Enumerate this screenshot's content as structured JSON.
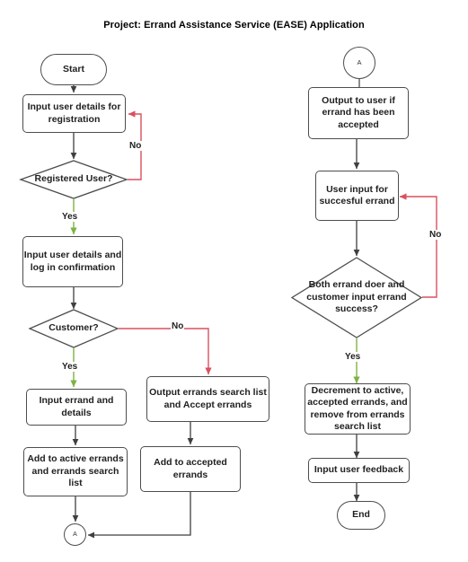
{
  "title": "Project: Errand Assistance Service (EASE) Application",
  "colors": {
    "node_stroke": "#4d4d4d",
    "flow_arrow": "#3f3f3f",
    "no_edge": "#d9515d",
    "yes_edge": "#7cb342",
    "text": "#1f1f1f",
    "background": "#ffffff"
  },
  "nodes": {
    "start": {
      "label": "Start",
      "shape": "terminal"
    },
    "input_registration": {
      "label": "Input user details for registration",
      "shape": "process"
    },
    "registered_user": {
      "label": "Registered User?",
      "shape": "decision"
    },
    "input_login": {
      "label": "Input user details and log in confirmation",
      "shape": "process"
    },
    "customer": {
      "label": "Customer?",
      "shape": "decision"
    },
    "input_errand": {
      "label": "Input errand and details",
      "shape": "process"
    },
    "add_active": {
      "label": "Add to active errands and errands search list",
      "shape": "process"
    },
    "output_search_list": {
      "label": "Output errands search list and Accept errands",
      "shape": "process"
    },
    "add_accepted": {
      "label": "Add to accepted errands",
      "shape": "process"
    },
    "connector_a_left": {
      "label": "A",
      "shape": "connector"
    },
    "connector_a_right": {
      "label": "A",
      "shape": "connector"
    },
    "output_accepted": {
      "label": "Output to user if errand has been accepted",
      "shape": "process"
    },
    "user_input_success": {
      "label": "User input for succesful errand",
      "shape": "process"
    },
    "both_success": {
      "label": "Both errand doer and customer input errand success?",
      "shape": "decision"
    },
    "decrement": {
      "label": "Decrement to active, accepted errands, and remove from errands search list",
      "shape": "process"
    },
    "input_feedback": {
      "label": "Input user feedback",
      "shape": "process"
    },
    "end": {
      "label": "End",
      "shape": "terminal"
    }
  },
  "edge_labels": {
    "registered_no": "No",
    "registered_yes": "Yes",
    "customer_no": "No",
    "customer_yes": "Yes",
    "success_no": "No",
    "success_yes": "Yes"
  }
}
